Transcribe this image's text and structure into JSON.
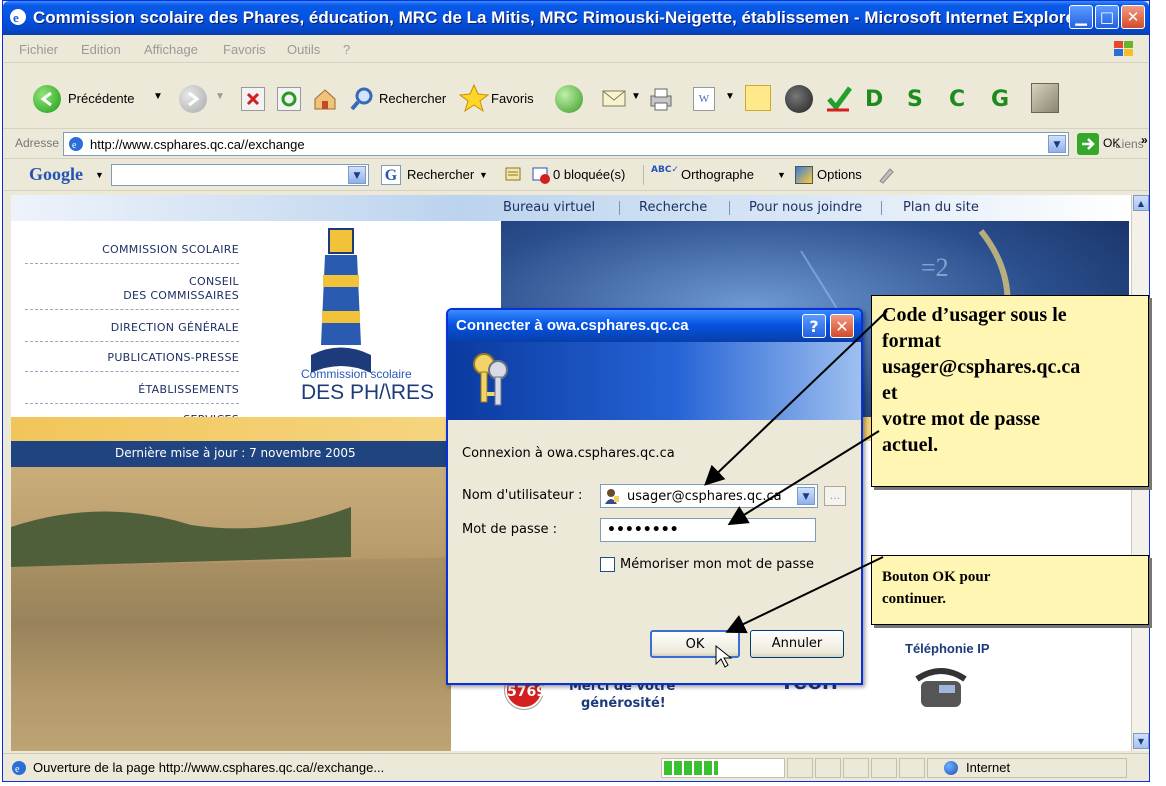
{
  "window": {
    "title": "Commission scolaire des Phares, éducation, MRC de La Mitis, MRC Rimouski-Neigette, établissemen - Microsoft Internet Explorer"
  },
  "menu": [
    "Fichier",
    "Edition",
    "Affichage",
    "Favoris",
    "Outils",
    "?"
  ],
  "toolbar": {
    "back_label": "Précédente",
    "search_label": "Rechercher",
    "favorites_label": "Favoris",
    "letters": [
      "D",
      "S",
      "C",
      "G"
    ]
  },
  "address": {
    "label": "Adresse",
    "url": "http://www.csphares.qc.ca//exchange",
    "go_label": "OK",
    "links_label": "Liens",
    "links_chevron": "»"
  },
  "google": {
    "logo": "Google",
    "search_label": "Rechercher",
    "blocked_label": "0 bloquée(s)",
    "spell_label": "Orthographe",
    "options_label": "Options"
  },
  "site": {
    "nav": [
      "Bureau virtuel",
      "Recherche",
      "Pour nous joindre",
      "Plan du site"
    ],
    "left_menu": [
      {
        "line1": "COMMISSION SCOLAIRE",
        "line2": ""
      },
      {
        "line1": "CONSEIL",
        "line2": "DES COMMISSAIRES"
      },
      {
        "line1": "DIRECTION GÉNÉRALE",
        "line2": ""
      },
      {
        "line1": "PUBLICATIONS-PRESSE",
        "line2": ""
      },
      {
        "line1": "ÉTABLISSEMENTS",
        "line2": ""
      },
      {
        "line1": "SERVICES",
        "line2": ""
      }
    ],
    "logo_small": "Commission scolaire",
    "logo_big": "DES PH/\\RES",
    "last_update": "Dernière mise à jour : 7 novembre 2005",
    "donation_number": "5769",
    "donation_text_1": "Merci de votre",
    "donation_text_2": "générosité!",
    "telephony_label": "Téléphonie IP"
  },
  "dialog": {
    "title": "Connecter à owa.csphares.qc.ca",
    "help_glyph": "?",
    "close_glyph": "✕",
    "connection_text": "Connexion à owa.csphares.qc.ca",
    "username_label": "Nom d'utilisateur :",
    "username_value": "usager@csphares.qc.ca",
    "password_label": "Mot de passe :",
    "password_value": "••••••••",
    "remember_label": "Mémoriser mon mot de passe",
    "ok_label": "OK",
    "cancel_label": "Annuler",
    "browse_label": "..."
  },
  "callouts": {
    "credentials": [
      "Code d’usager sous le",
      "format",
      "usager@csphares.qc.ca",
      "et",
      "votre mot de passe",
      "actuel."
    ],
    "ok": [
      "Bouton OK pour",
      "continuer."
    ]
  },
  "status": {
    "text": "Ouverture de la page http://www.csphares.qc.ca//exchange...",
    "zone": "Internet",
    "progress_fraction": 0.45
  }
}
